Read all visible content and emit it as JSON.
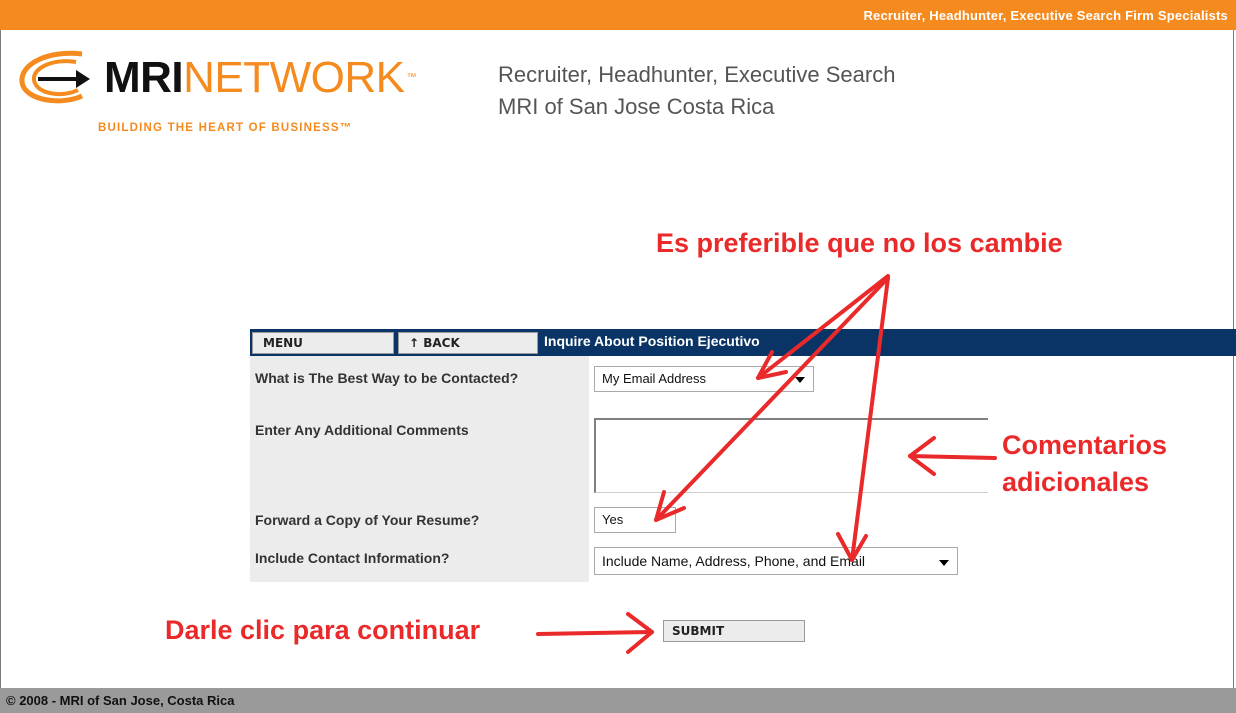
{
  "topbar": {
    "tagline": "Recruiter, Headhunter, Executive Search Firm Specialists"
  },
  "logo": {
    "mri": "MRI",
    "network": "NETWORK",
    "tm": "™",
    "tagline": "BUILDING THE HEART OF BUSINESS™"
  },
  "header": {
    "line1": "Recruiter, Headhunter, Executive Search",
    "line2": "MRI of San Jose Costa Rica"
  },
  "nav": {
    "menu_label": "MENU",
    "back_label": "↑ BACK",
    "title": "Inquire About Position Ejecutivo"
  },
  "form": {
    "contact_label": "What is The Best Way to be Contacted?",
    "contact_value": "My Email Address",
    "comments_label": "Enter Any Additional Comments",
    "comments_value": "",
    "resume_label": "Forward a Copy of Your Resume?",
    "resume_value": "Yes",
    "include_label": "Include Contact Information?",
    "include_value": "Include Name, Address, Phone, and Email",
    "submit_label": "SUBMIT"
  },
  "annotations": {
    "preferable": "Es preferible que no los cambie",
    "comments_line1": "Comentarios",
    "comments_line2": "adicionales",
    "click_continue": "Darle clic para continuar"
  },
  "footer": {
    "copyright": "© 2008 - MRI of San Jose, Costa Rica"
  },
  "colors": {
    "brand_orange": "#f58a1f",
    "nav_blue": "#0b3466",
    "annotation_red": "#ea2a2a",
    "footer_gray": "#9a9a9a"
  },
  "icons": [
    "mri-swoosh-logo-icon",
    "dropdown-arrow-icon",
    "annotation-arrow-icon"
  ]
}
